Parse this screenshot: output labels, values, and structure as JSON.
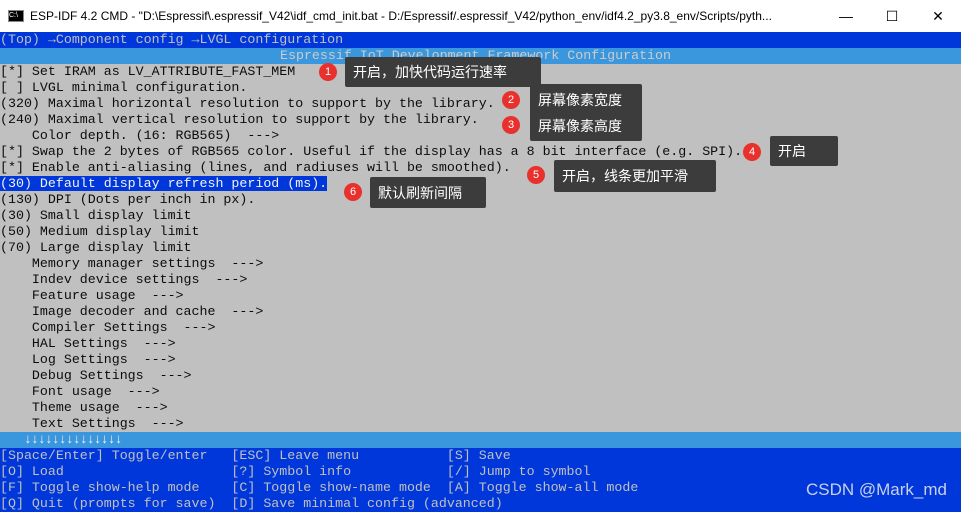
{
  "window": {
    "title": "ESP-IDF 4.2 CMD - \"D:\\Espressif\\.espressif_V42\\idf_cmd_init.bat - D:/Espressif/.espressif_V42/python_env/idf4.2_py3.8_env/Scripts/pyth...",
    "minimize": "—",
    "maximize": "☐",
    "close": "✕"
  },
  "path": "(Top) →Component config →LVGL configuration",
  "header": "Espressif IoT Development Framework Configuration",
  "items": [
    "[*] Set IRAM as LV_ATTRIBUTE_FAST_MEM",
    "[ ] LVGL minimal configuration.",
    "(320) Maximal horizontal resolution to support by the library.",
    "(240) Maximal vertical resolution to support by the library.",
    "    Color depth. (16: RGB565)  --->",
    "[*] Swap the 2 bytes of RGB565 color. Useful if the display has a 8 bit interface (e.g. SPI).",
    "[*] Enable anti-aliasing (lines, and radiuses will be smoothed).",
    "(30) Default display refresh period (ms).",
    "(130) DPI (Dots per inch in px).",
    "(30) Small display limit",
    "(50) Medium display limit",
    "(70) Large display limit",
    "    Memory manager settings  --->",
    "    Indev device settings  --->",
    "    Feature usage  --->",
    "    Image decoder and cache  --->",
    "    Compiler Settings  --->",
    "    HAL Settings  --->",
    "    Log Settings  --->",
    "    Debug Settings  --->",
    "    Font usage  --->",
    "    Theme usage  --->",
    "    Text Settings  --->"
  ],
  "selected_index": 7,
  "scroll_indicator": "↓↓↓↓↓↓↓↓↓↓↓↓↓↓",
  "footer": [
    "[Space/Enter] Toggle/enter   [ESC] Leave menu           [S] Save",
    "[O] Load                     [?] Symbol info            [/] Jump to symbol",
    "[F] Toggle show-help mode    [C] Toggle show-name mode  [A] Toggle show-all mode",
    "[Q] Quit (prompts for save)  [D] Save minimal config (advanced)"
  ],
  "annotations": [
    {
      "n": "1",
      "text": "开启，加快代码运行速率"
    },
    {
      "n": "2",
      "text": "屏幕像素宽度"
    },
    {
      "n": "3",
      "text": "屏幕像素高度"
    },
    {
      "n": "4",
      "text": "开启"
    },
    {
      "n": "5",
      "text": "开启，线条更加平滑"
    },
    {
      "n": "6",
      "text": "默认刷新间隔"
    }
  ],
  "watermark": "CSDN @Mark_md",
  "colors": {
    "path_bg": "#0037da",
    "header_bg": "#3a96dd",
    "body_bg": "#c0c0c0",
    "annotation_bg": "#3c3c3c",
    "badge": "#e8302c"
  }
}
